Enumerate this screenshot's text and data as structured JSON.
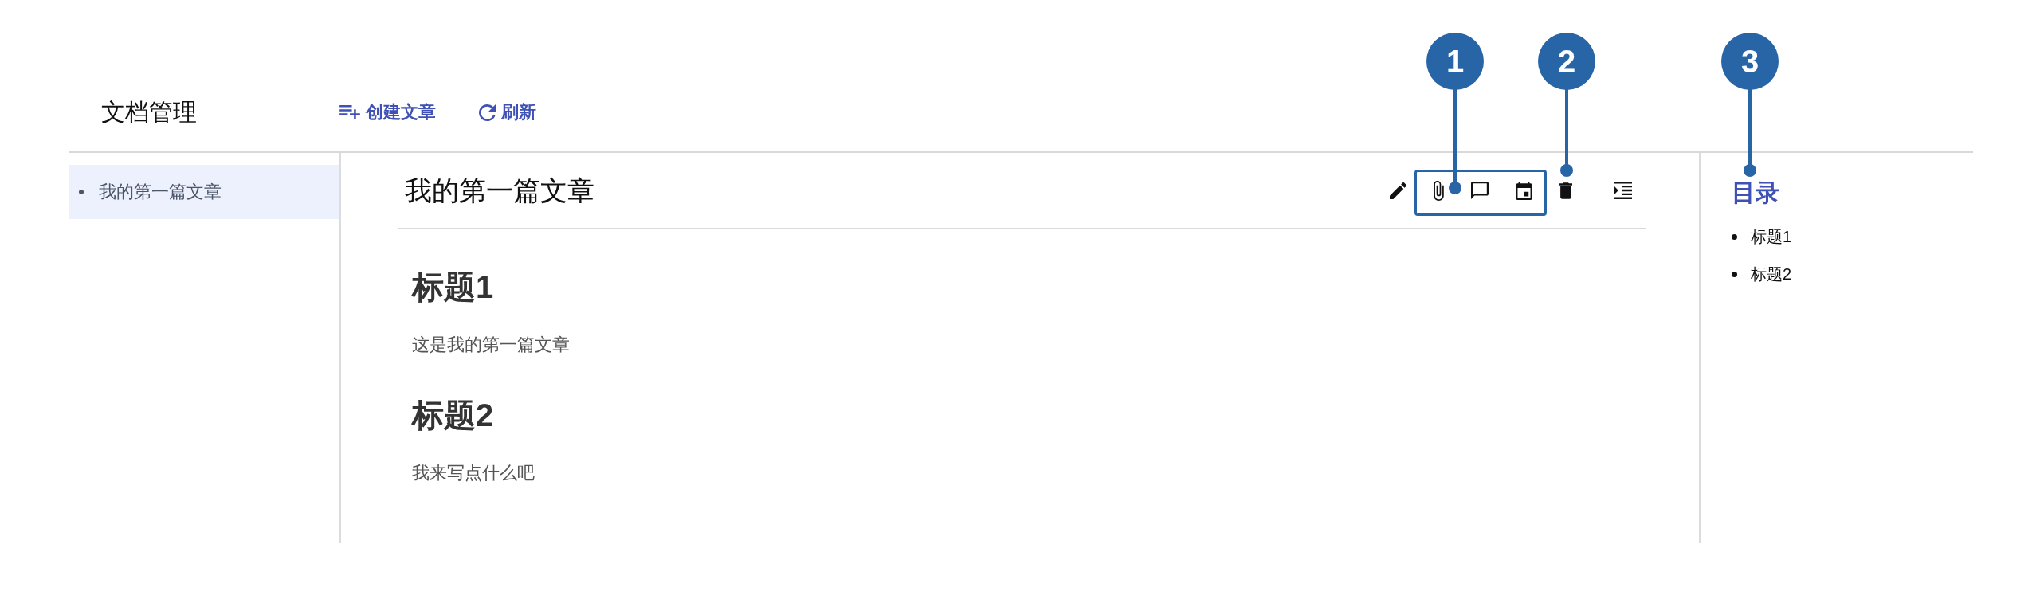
{
  "header": {
    "title": "文档管理",
    "actions": [
      {
        "label": "创建文章"
      },
      {
        "label": "刷新"
      }
    ]
  },
  "sidebar": {
    "items": [
      {
        "label": "我的第一篇文章",
        "selected": true
      }
    ]
  },
  "article": {
    "title": "我的第一篇文章",
    "blocks": [
      {
        "kind": "heading",
        "text": "标题1"
      },
      {
        "kind": "paragraph",
        "text": "这是我的第一篇文章"
      },
      {
        "kind": "heading",
        "text": "标题2"
      },
      {
        "kind": "paragraph",
        "text": "我来写点什么吧"
      }
    ]
  },
  "toc": {
    "title": "目录",
    "items": [
      {
        "label": "标题1"
      },
      {
        "label": "标题2"
      }
    ]
  },
  "annotations": [
    {
      "label": "1",
      "kind": "frame"
    },
    {
      "label": "2",
      "kind": "point"
    },
    {
      "label": "3",
      "kind": "point"
    }
  ]
}
